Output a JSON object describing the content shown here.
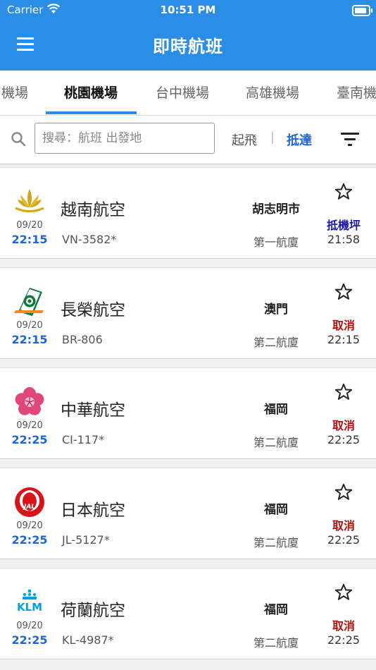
{
  "status_bar": {
    "carrier": "Carrier",
    "time": "10:51 PM",
    "battery_level": 1.0
  },
  "header": {
    "title": "即時航班",
    "menu_icon": "hamburger-menu-icon",
    "background": "#2b8ee6"
  },
  "tabs": [
    {
      "label": "機場",
      "active": false
    },
    {
      "label": "桃園機場",
      "active": true
    },
    {
      "label": "台中機場",
      "active": false
    },
    {
      "label": "高雄機場",
      "active": false
    },
    {
      "label": "臺南機",
      "active": false
    }
  ],
  "search": {
    "placeholder": "搜尋：航班 出發地",
    "value": "",
    "departure_label": "起飛",
    "separator": "|",
    "arrival_label": "抵達",
    "selected": "arrival",
    "filter_icon": "filter-icon"
  },
  "colors": {
    "accent": "#2b8ee6",
    "time_blue": "#1c66d6",
    "landed": "#1a1aa8",
    "cancelled": "#b00d0d"
  },
  "flights": [
    {
      "airline": "越南航空",
      "flight_no": "VN-3582*",
      "date": "09/20",
      "scheduled": "22:15",
      "origin": "胡志明市",
      "terminal": "第一航廈",
      "status": "抵機坪",
      "status_color": "#1a1aa8",
      "actual": "21:58",
      "logo": "vietnam-airlines-lotus-logo"
    },
    {
      "airline": "長榮航空",
      "flight_no": "BR-806",
      "date": "09/20",
      "scheduled": "22:15",
      "origin": "澳門",
      "terminal": "第二航廈",
      "status": "取消",
      "status_color": "#b00d0d",
      "actual": "22:15",
      "logo": "eva-air-logo"
    },
    {
      "airline": "中華航空",
      "flight_no": "CI-117*",
      "date": "09/20",
      "scheduled": "22:25",
      "origin": "福岡",
      "terminal": "第二航廈",
      "status": "取消",
      "status_color": "#b00d0d",
      "actual": "22:25",
      "logo": "china-airlines-plum-blossom-logo"
    },
    {
      "airline": "日本航空",
      "flight_no": "JL-5127*",
      "date": "09/20",
      "scheduled": "22:25",
      "origin": "福岡",
      "terminal": "第二航廈",
      "status": "取消",
      "status_color": "#b00d0d",
      "actual": "22:25",
      "logo": "jal-crane-logo",
      "logo_text": "JAL"
    },
    {
      "airline": "荷蘭航空",
      "flight_no": "KL-4987*",
      "date": "09/20",
      "scheduled": "22:25",
      "origin": "福岡",
      "terminal": "第二航廈",
      "status": "取消",
      "status_color": "#b00d0d",
      "actual": "22:25",
      "logo": "klm-logo",
      "logo_text": "KLM"
    }
  ]
}
